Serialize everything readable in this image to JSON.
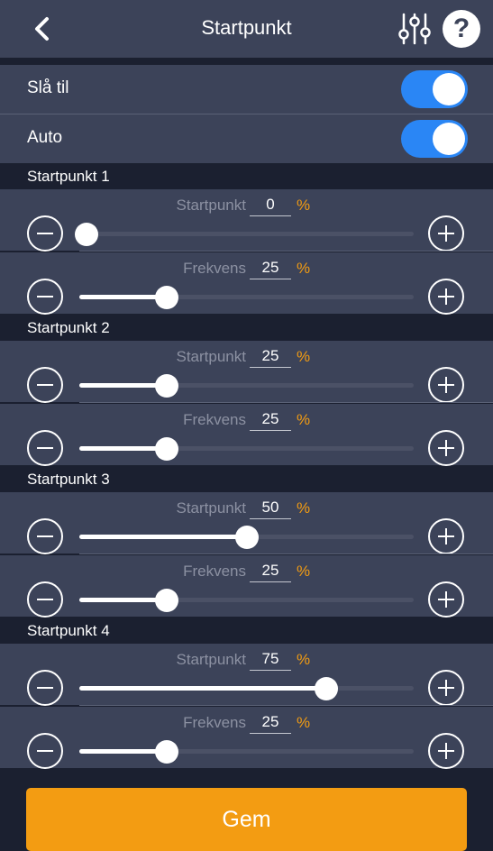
{
  "header": {
    "title": "Startpunkt",
    "back_icon": "chevron-left-icon",
    "settings_icon": "sliders-icon",
    "help_icon": "help-icon",
    "help_glyph": "?"
  },
  "toggles": [
    {
      "label": "Slå til",
      "on": true
    },
    {
      "label": "Auto",
      "on": true
    }
  ],
  "sections": [
    {
      "title": "Startpunkt 1",
      "sliders": [
        {
          "label": "Startpunkt",
          "value": "0",
          "unit": "%",
          "fraction": 0.0
        },
        {
          "label": "Frekvens",
          "value": "25",
          "unit": "%",
          "fraction": 0.25
        }
      ]
    },
    {
      "title": "Startpunkt 2",
      "sliders": [
        {
          "label": "Startpunkt",
          "value": "25",
          "unit": "%",
          "fraction": 0.25
        },
        {
          "label": "Frekvens",
          "value": "25",
          "unit": "%",
          "fraction": 0.25
        }
      ]
    },
    {
      "title": "Startpunkt 3",
      "sliders": [
        {
          "label": "Startpunkt",
          "value": "50",
          "unit": "%",
          "fraction": 0.5
        },
        {
          "label": "Frekvens",
          "value": "25",
          "unit": "%",
          "fraction": 0.25
        }
      ]
    },
    {
      "title": "Startpunkt 4",
      "sliders": [
        {
          "label": "Startpunkt",
          "value": "75",
          "unit": "%",
          "fraction": 0.75
        },
        {
          "label": "Frekvens",
          "value": "25",
          "unit": "%",
          "fraction": 0.25
        }
      ]
    }
  ],
  "save_button": {
    "label": "Gem"
  },
  "colors": {
    "background": "#1b2030",
    "panel": "#3c4359",
    "accent": "#f39c12",
    "toggle_on": "#2a86f5"
  }
}
